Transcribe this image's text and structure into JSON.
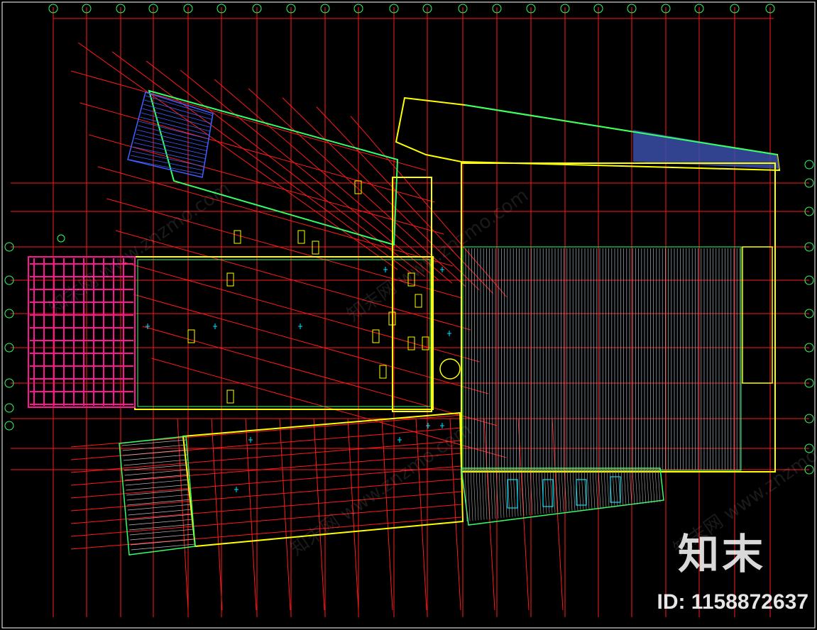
{
  "watermark": {
    "logo_text": "知末",
    "id_text": "ID: 1158872637",
    "site_text": "知末网 www.znzmo.com"
  },
  "colors": {
    "background": "#000000",
    "grid": "#ff1a1a",
    "wall_yellow": "#ffff00",
    "wall_green": "#33ff66",
    "cyan": "#00e5ff",
    "magenta": "#ff1493",
    "blue_fill": "#3a4fa8",
    "stair_blue": "#4060ff",
    "white": "#ffffff"
  }
}
